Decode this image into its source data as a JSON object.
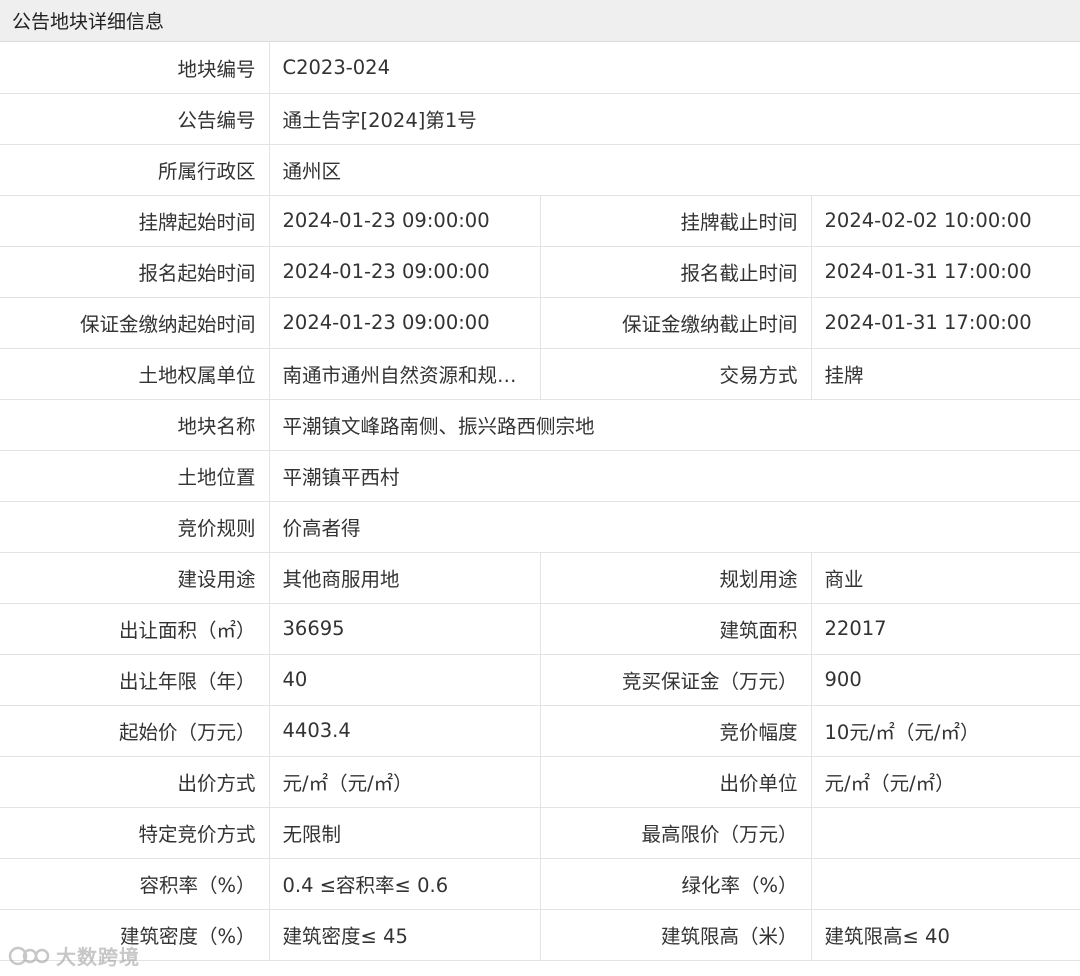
{
  "header": {
    "title": "公告地块详细信息"
  },
  "rows": [
    {
      "full": true,
      "label": "地块编号",
      "value": "C2023-024"
    },
    {
      "full": true,
      "label": "公告编号",
      "value": "通土告字[2024]第1号"
    },
    {
      "full": true,
      "label": "所属行政区",
      "value": "通州区"
    },
    {
      "full": false,
      "label": "挂牌起始时间",
      "value": "2024-01-23 09:00:00",
      "label2": "挂牌截止时间",
      "value2": "2024-02-02 10:00:00"
    },
    {
      "full": false,
      "label": "报名起始时间",
      "value": "2024-01-23 09:00:00",
      "label2": "报名截止时间",
      "value2": "2024-01-31 17:00:00"
    },
    {
      "full": false,
      "label": "保证金缴纳起始时间",
      "value": "2024-01-23 09:00:00",
      "label2": "保证金缴纳截止时间",
      "value2": "2024-01-31 17:00:00"
    },
    {
      "full": false,
      "label": "土地权属单位",
      "value": "南通市通州自然资源和规…",
      "label2": "交易方式",
      "value2": "挂牌"
    },
    {
      "full": true,
      "label": "地块名称",
      "value": "平潮镇文峰路南侧、振兴路西侧宗地"
    },
    {
      "full": true,
      "label": "土地位置",
      "value": "平潮镇平西村"
    },
    {
      "full": true,
      "label": "竞价规则",
      "value": "价高者得"
    },
    {
      "full": false,
      "label": "建设用途",
      "value": "其他商服用地",
      "label2": "规划用途",
      "value2": "商业"
    },
    {
      "full": false,
      "label": "出让面积（㎡）",
      "value": "36695",
      "label2": "建筑面积",
      "value2": "22017"
    },
    {
      "full": false,
      "label": "出让年限（年）",
      "value": "40",
      "label2": "竞买保证金（万元）",
      "value2": "900"
    },
    {
      "full": false,
      "label": "起始价（万元）",
      "value": "4403.4",
      "label2": "竞价幅度",
      "value2": "10元/㎡（元/㎡）"
    },
    {
      "full": false,
      "label": "出价方式",
      "value": "元/㎡（元/㎡）",
      "label2": "出价单位",
      "value2": "元/㎡（元/㎡）"
    },
    {
      "full": false,
      "label": "特定竞价方式",
      "value": "无限制",
      "label2": "最高限价（万元）",
      "value2": ""
    },
    {
      "full": false,
      "label": "容积率（%）",
      "value": "0.4 ≤容积率≤ 0.6",
      "label2": "绿化率（%）",
      "value2": ""
    },
    {
      "full": false,
      "label": "建筑密度（%）",
      "value": "建筑密度≤ 45",
      "label2": "建筑限高（米）",
      "value2": "建筑限高≤ 40"
    }
  ],
  "watermark": {
    "text": "大数跨境"
  }
}
